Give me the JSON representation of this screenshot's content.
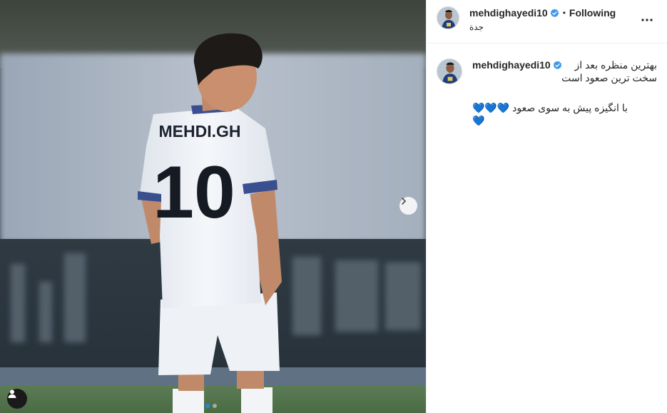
{
  "post": {
    "username": "mehdighayedi10",
    "follow_status": "Following",
    "separator": "•",
    "location": "جدة",
    "caption": {
      "line1_right": "بهترین منظره بعد از",
      "line2": "سخت ترین صعود است",
      "line3": "با انگیزه پیش به سوی صعود 💙💙💙",
      "line4": "💙"
    }
  },
  "media": {
    "jersey_name": "MEHDI.GH",
    "jersey_number": "10",
    "carousel_dots": 2,
    "active_dot": 1
  },
  "colors": {
    "verified": "#3897f0",
    "heart": "#1f7ad8",
    "active_dot": "#1e88e5"
  },
  "icons": [
    "verified-icon",
    "more-options-icon",
    "chevron-right-icon",
    "user-tag-icon"
  ]
}
